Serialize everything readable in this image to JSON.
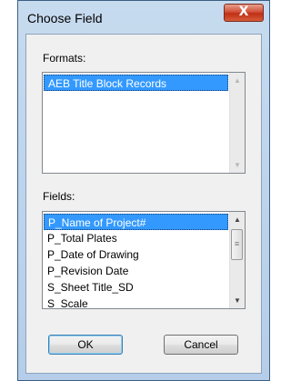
{
  "window": {
    "title": "Choose Field",
    "close_glyph": "X"
  },
  "formats": {
    "label": "Formats:",
    "items": [
      "AEB Title Block Records"
    ],
    "selected_index": 0
  },
  "fields": {
    "label": "Fields:",
    "items": [
      "P_Name of Project#",
      "P_Total Plates",
      "P_Date of Drawing",
      "P_Revision Date",
      "S_Sheet Title_SD",
      "S_Scale"
    ],
    "selected_index": 0
  },
  "buttons": {
    "ok": "OK",
    "cancel": "Cancel"
  },
  "icons": {
    "up": "chevron-up-icon",
    "down": "chevron-down-icon",
    "grip": "grip-icon"
  }
}
